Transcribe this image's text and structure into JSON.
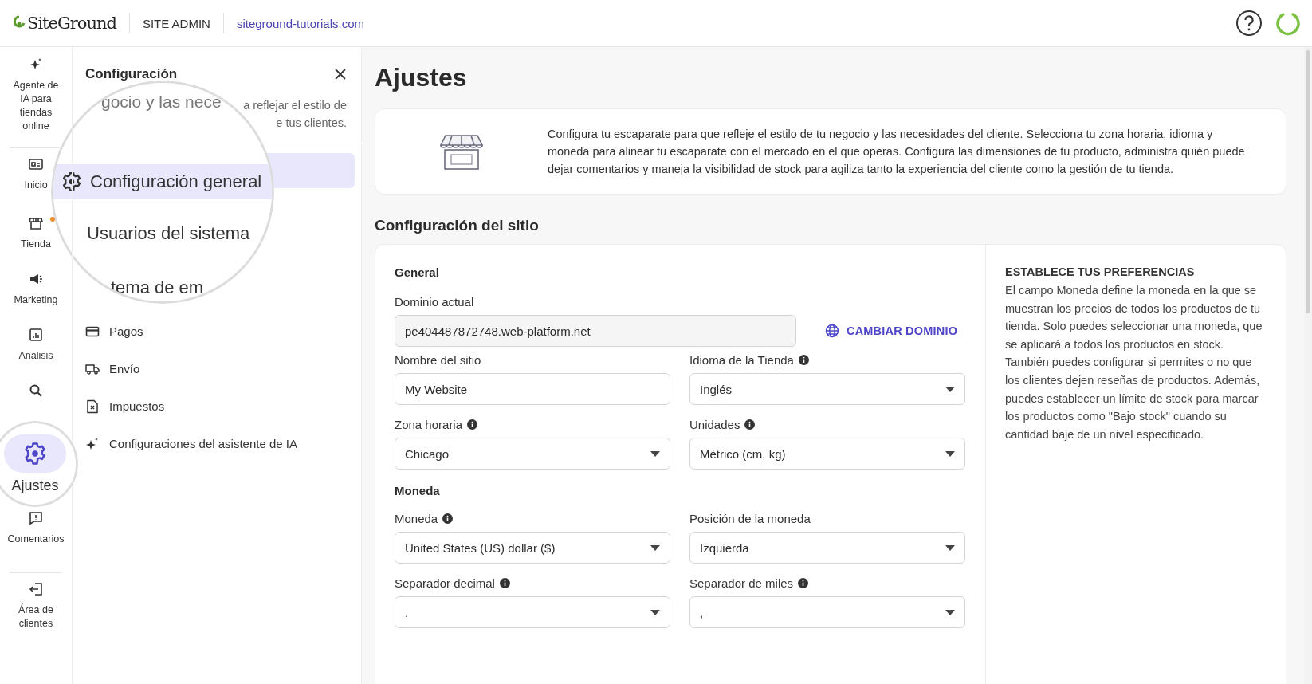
{
  "header": {
    "logo": "SiteGround",
    "section": "SITE ADMIN",
    "domain": "siteground-tutorials.com"
  },
  "rail": [
    {
      "label": "Agente de IA para tiendas online",
      "selected": false,
      "dot": false
    },
    {
      "label": "Inicio",
      "selected": false,
      "dot": false
    },
    {
      "label": "Tienda",
      "selected": false,
      "dot": true
    },
    {
      "label": "Marketing",
      "selected": false,
      "dot": false
    },
    {
      "label": "Análisis",
      "selected": false,
      "dot": false
    },
    {
      "selected": false,
      "dot": false
    },
    {
      "label": "Ajustes",
      "selected": true,
      "dot": false
    },
    {
      "label": "Comentarios",
      "selected": false,
      "dot": false
    },
    {
      "label": "Área de clientes",
      "selected": false,
      "dot": false
    }
  ],
  "panel": {
    "title": "Configuración",
    "description": [
      "a reflejar el estilo de",
      "e tus clientes."
    ],
    "magnifier": {
      "top": "gocio y las nece",
      "items": [
        {
          "label": "Configuración general",
          "selected": true
        },
        {
          "label": "Usuarios del sistema",
          "selected": false
        }
      ],
      "bottom": "tema de em"
    },
    "items": [
      {
        "label": "Pagos"
      },
      {
        "label": "Envío"
      },
      {
        "label": "Impuestos"
      },
      {
        "label": "Configuraciones del asistente de IA"
      }
    ]
  },
  "page": {
    "title": "Ajustes",
    "intro": "Configura tu escaparate para que refleje el estilo de tu negocio y las necesidades del cliente. Selecciona tu zona horaria, idioma y moneda para alinear tu escaparate con el mercado en el que operas. Configura las dimensiones de tu producto, administra quién puede dejar comentarios y maneja la visibilidad de stock para agiliza tanto la experiencia del cliente como la gestión de tu tienda.",
    "section": "Configuración del sitio",
    "general": {
      "heading": "General",
      "domain": {
        "label": "Dominio actual",
        "value": "pe404487872748.web-platform.net"
      },
      "change_button": "CAMBIAR DOMINIO",
      "fields": [
        {
          "label": "Nombre del sitio",
          "info": false,
          "kind": "input",
          "value": "My Website"
        },
        {
          "label": "Idioma de la Tienda",
          "info": true,
          "kind": "select",
          "value": "Inglés"
        },
        {
          "label": "Zona horaria",
          "info": true,
          "kind": "select",
          "value": "Chicago"
        },
        {
          "label": "Unidades",
          "info": true,
          "kind": "select",
          "value": "Métrico (cm, kg)"
        }
      ]
    },
    "currency": {
      "heading": "Moneda",
      "fields": [
        {
          "label": "Moneda",
          "info": true,
          "kind": "select",
          "value": "United States (US) dollar ($)"
        },
        {
          "label": "Posición de la moneda",
          "info": false,
          "kind": "select",
          "value": "Izquierda"
        },
        {
          "label": "Separador decimal",
          "info": true,
          "kind": "select",
          "value": "."
        },
        {
          "label": "Separador de miles",
          "info": true,
          "kind": "select",
          "value": ","
        }
      ]
    },
    "help": {
      "title": "ESTABLECE TUS PREFERENCIAS",
      "text": "El campo Moneda define la moneda en la que se muestran los precios de todos los productos de tu tienda. Solo puedes seleccionar una moneda, que se aplicará a todos los productos en stock. También puedes configurar si permites o no que los clientes dejen reseñas de productos. Además, puedes establecer un límite de stock para marcar los productos como \"Bajo stock\" cuando su cantidad baje de un nivel especificado."
    }
  }
}
